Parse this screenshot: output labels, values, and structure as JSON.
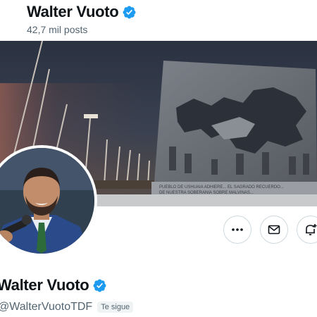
{
  "header": {
    "display_name": "Walter Vuoto",
    "posts_count": "42,7 mil posts"
  },
  "profile": {
    "display_name": "Walter Vuoto",
    "handle": "@WalterVuotoTDF",
    "follows_you": "Te sigue"
  },
  "banner": {
    "monument_inscription": "PUEBLO DE USHUAIA ADHIERE... EL SAGRADO RECUERDO DE LOS CAIDOS... DE NUESTRA SOBERANIA SOBRE MALVINAS..."
  },
  "icons": {
    "verified": "verified-badge-icon",
    "more": "more-dots-icon",
    "message": "envelope-icon",
    "notifications": "bell-plus-icon"
  },
  "colors": {
    "verified_blue": "#1d9bf0",
    "text_primary": "#0f1419",
    "text_secondary": "#536471",
    "border": "#cfd9de"
  }
}
